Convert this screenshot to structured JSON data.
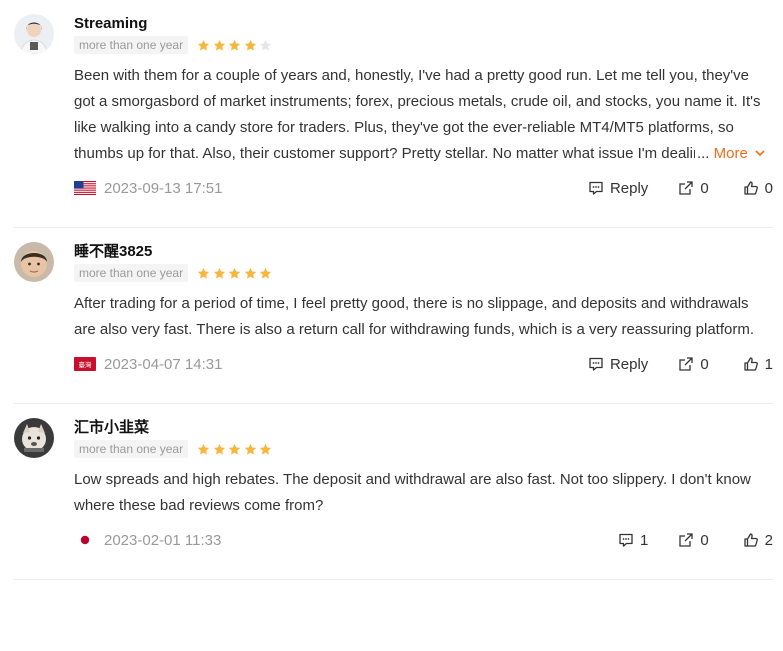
{
  "reviews": [
    {
      "name": "Streaming",
      "badge": "more than one year",
      "rating": 4,
      "text": "Been with them for a couple of years and, honestly, I've had a pretty good run. Let me tell you, they've got a smorgasbord of market instruments; forex, precious metals, crude oil, and stocks, you name it. It's like walking into a candy store for traders. Plus, they've got the ever-reliable MT4/MT5 platforms, so thumbs up for that. Also, their customer support? Pretty stellar. No matter what issue I'm dealing with, these guys are always on standby, ready to help out. Few things to consider, though. They've",
      "more_prefix": "...",
      "more_label": "More",
      "flag": "us-flag",
      "date": "2023-09-13 17:51",
      "reply_label": "Reply",
      "shares": "0",
      "likes": "0"
    },
    {
      "name": "睡不醒3825",
      "badge": "more than one year",
      "rating": 5,
      "text": "After trading for a period of time, I feel pretty good, there is no slippage, and deposits and withdrawals are also very fast. There is also a return call for withdrawing funds, which is a very reassuring platform.",
      "flag": "taiwan-region-flag",
      "flag_text": "臺灣",
      "date": "2023-04-07 14:31",
      "reply_label": "Reply",
      "shares": "0",
      "likes": "1"
    },
    {
      "name": "汇市小韭菜",
      "badge": "more than one year",
      "rating": 5,
      "text": "Low spreads and high rebates. The deposit and withdrawal are also fast. Not too slippery. I don't know where these bad reviews come from?",
      "flag": "japan-flag",
      "date": "2023-02-01 11:33",
      "replies": "1",
      "shares": "0",
      "likes": "2"
    }
  ],
  "colors": {
    "star": "#f6b73c",
    "star_empty": "#e6e6e6",
    "more": "#f26a1b",
    "date": "#999999"
  }
}
